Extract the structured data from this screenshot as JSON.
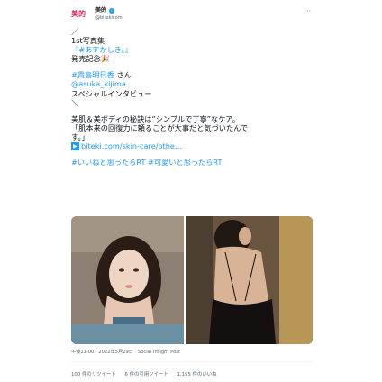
{
  "account": {
    "logo_text": "美的",
    "name": "美的",
    "handle": "@bitekicom",
    "verified_icon": "check-icon"
  },
  "tweet": {
    "line1": "／",
    "line2": "1st写真集",
    "line3": "『#あすかしき。』",
    "line4": "発売記念🎉",
    "line5": "#貴島明日香",
    "line5_suffix": " さん",
    "line6": "@asuka_kijima",
    "line7": "スペシャルインタビュー",
    "line8": "＼",
    "line9": "美肌＆美ボディの秘訣は“シンプルで丁寧”なケア。",
    "line10": "「肌本来の回復力に頼ることが大事だと気づいたんで",
    "line11": "す。」",
    "link": "biteki.com/skin-care/othe…",
    "hashtags": "#いいねと思ったらRT #可愛いと思ったらRT"
  },
  "meta": {
    "text": "午後11:00 · 2022年5月29日 · Social Insight Post"
  },
  "stats": {
    "retweets": "100 件のリツイート",
    "quotes": "6 件の引用ツイート",
    "likes": "1,155 件のいいね"
  },
  "colors": {
    "accent": "#1d9bf0",
    "logo": "#e0245e"
  }
}
